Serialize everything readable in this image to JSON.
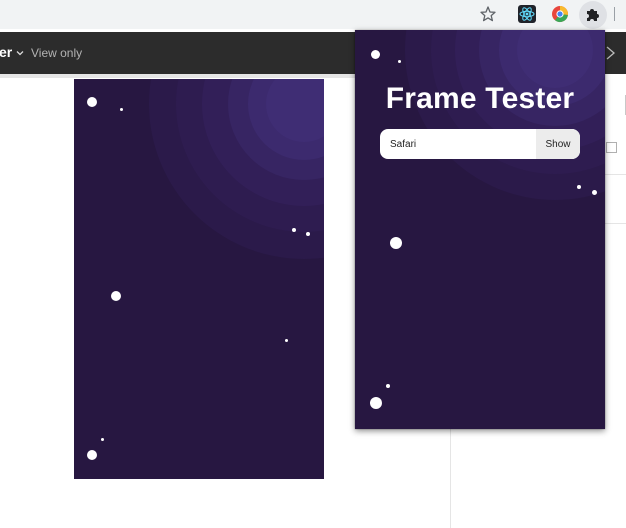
{
  "browser": {
    "icons": [
      "bookmark-star-icon",
      "react-devtools-icon",
      "colorful-extension-icon",
      "extensions-puzzle-icon"
    ]
  },
  "app": {
    "title_fragment": "er",
    "view_mode": "View only",
    "icons": [
      "chevron-down-icon",
      "chevron-right-icon"
    ]
  },
  "popup": {
    "title": "Frame Tester",
    "device_value": "Safari",
    "show_label": "Show"
  },
  "colors": {
    "frame_background": "#271741",
    "glow_accent": "#3f2a7a",
    "header_background": "#2c2c2c",
    "toolbar_background": "#f1f3f4"
  }
}
